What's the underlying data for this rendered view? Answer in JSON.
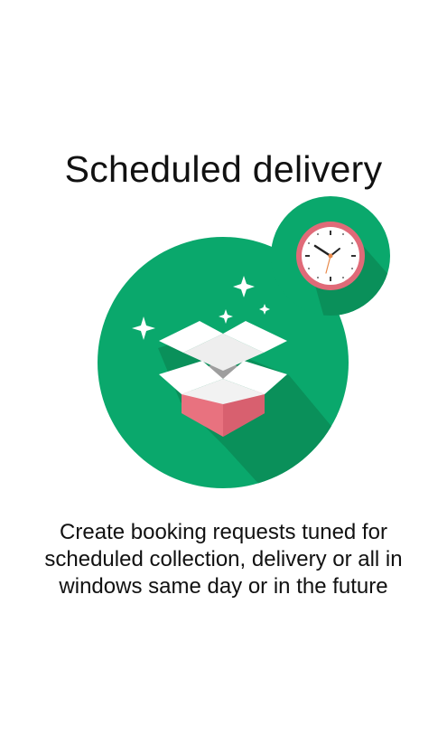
{
  "screen": {
    "title": "Scheduled delivery",
    "description": "Create booking requests tuned for scheduled collection, delivery or all in windows same day or in the future"
  },
  "illustration": {
    "icons": [
      "open-box-icon",
      "clock-icon",
      "sparkle-icon"
    ],
    "colors": {
      "circle_green": "#0aa86c",
      "shadow_green": "#0a8d59",
      "box_pink": "#e8727f",
      "box_white": "#ffffff",
      "box_gray": "#9e9e9e",
      "clock_ring": "#e06a78"
    }
  }
}
